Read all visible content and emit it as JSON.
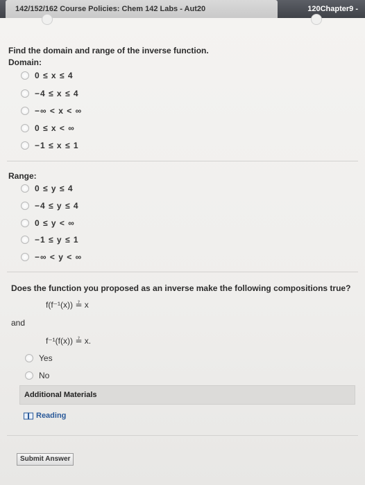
{
  "tabs": {
    "left": "142/152/162 Course Policies: Chem 142 Labs - Aut20",
    "right": "120Chapter9 -"
  },
  "question1": "Find the domain and range of the inverse function.",
  "domain": {
    "label": "Domain:",
    "options": [
      "0 ≤ x ≤ 4",
      "−4 ≤ x ≤ 4",
      "−∞ < x < ∞",
      "0 ≤ x < ∞",
      "−1 ≤ x ≤ 1"
    ]
  },
  "range": {
    "label": "Range:",
    "options": [
      "0 ≤ y ≤ 4",
      "−4 ≤ y ≤ 4",
      "0 ≤ y < ∞",
      "−1 ≤ y ≤ 1",
      "−∞ < y < ∞"
    ]
  },
  "question2": "Does the function you proposed as an inverse make the following compositions true?",
  "composition1": "f(f⁻¹(x)) ≟ x",
  "and_label": "and",
  "composition2": "f⁻¹(f(x)) ≟ x.",
  "yesno": {
    "yes": "Yes",
    "no": "No"
  },
  "additional_materials": "Additional Materials",
  "reading": "Reading",
  "submit": "Submit Answer"
}
